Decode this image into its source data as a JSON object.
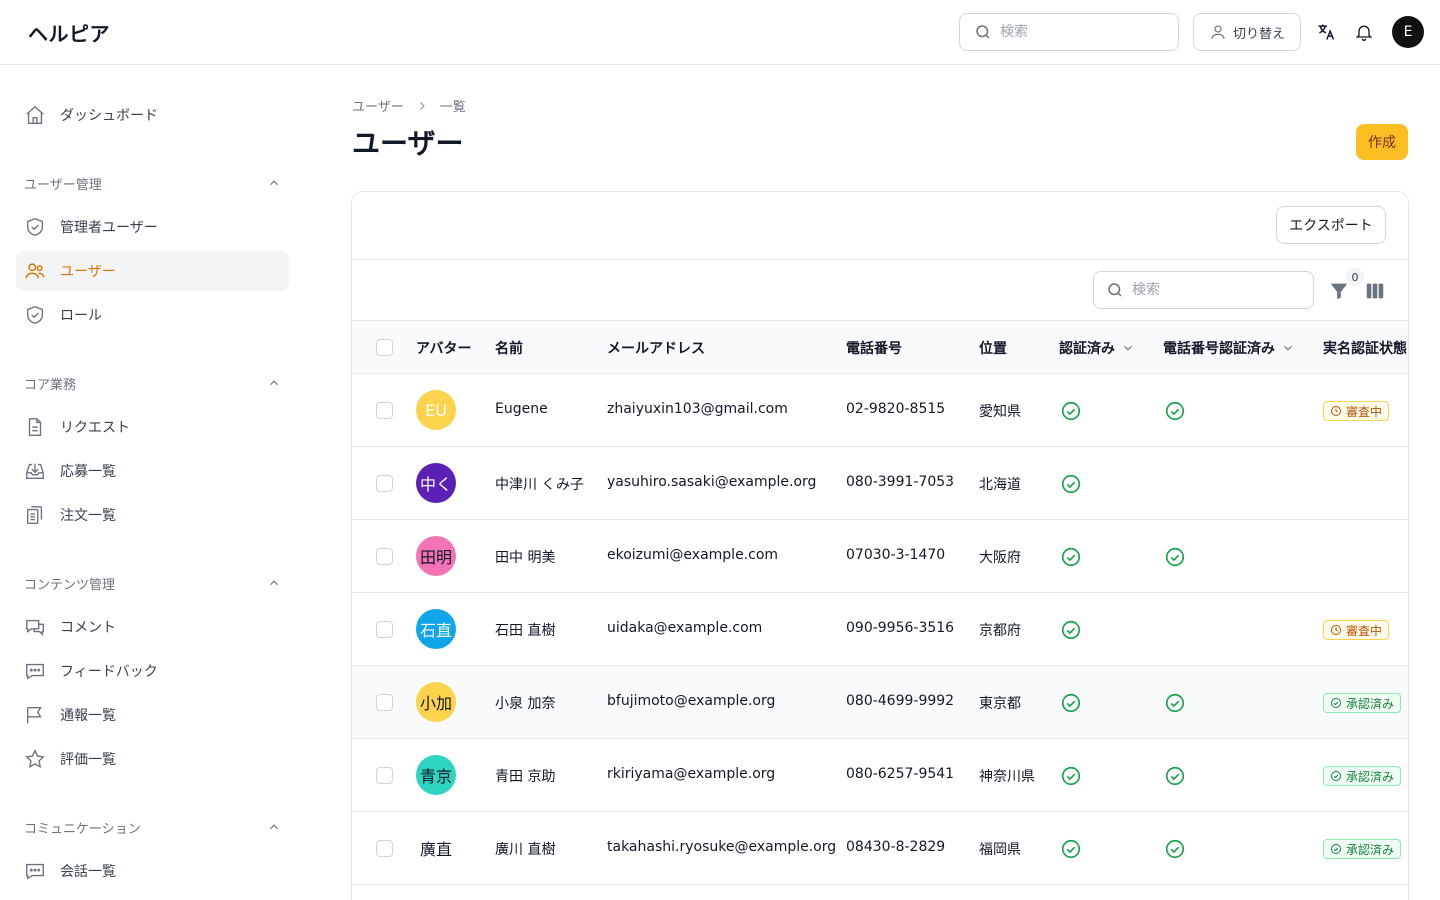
{
  "app": {
    "brand": "ヘルピア",
    "user_initial": "E"
  },
  "header": {
    "search_placeholder": "検索",
    "switch_label": "切り替え"
  },
  "sidebar": {
    "dashboard": "ダッシュボード",
    "groups": [
      {
        "title": "ユーザー管理",
        "items": [
          "管理者ユーザー",
          "ユーザー",
          "ロール"
        ]
      },
      {
        "title": "コア業務",
        "items": [
          "リクエスト",
          "応募一覧",
          "注文一覧"
        ]
      },
      {
        "title": "コンテンツ管理",
        "items": [
          "コメント",
          "フィードバック",
          "通報一覧",
          "評価一覧"
        ]
      },
      {
        "title": "コミュニケーション",
        "items": [
          "会話一覧"
        ]
      }
    ]
  },
  "page": {
    "breadcrumb": [
      "ユーザー",
      "一覧"
    ],
    "title": "ユーザー",
    "create_label": "作成",
    "export_label": "エクスポート",
    "table_search_placeholder": "検索",
    "filter_count": "0"
  },
  "table": {
    "columns": [
      "アバター",
      "名前",
      "メールアドレス",
      "電話番号",
      "位置",
      "認証済み",
      "電話番号認証済み",
      "実名認証状態"
    ],
    "rows": [
      {
        "avatar": "EU",
        "avatar_color": "#fcd34d",
        "avatar_text": "#ffffff",
        "name": "Eugene",
        "email": "zhaiyuxin103@gmail.com",
        "phone": "02-9820-8515",
        "location": "愛知県",
        "verified": true,
        "phone_verified": true,
        "kyc": "審査中"
      },
      {
        "avatar": "中く",
        "avatar_color": "#5b21b6",
        "avatar_text": "#ffffff",
        "name": "中津川 くみ子",
        "email": "yasuhiro.sasaki@example.org",
        "phone": "080-3991-7053",
        "location": "北海道",
        "verified": true,
        "phone_verified": false,
        "kyc": ""
      },
      {
        "avatar": "田明",
        "avatar_color": "#f472b6",
        "avatar_text": "#111827",
        "name": "田中 明美",
        "email": "ekoizumi@example.com",
        "phone": "07030-3-1470",
        "location": "大阪府",
        "verified": true,
        "phone_verified": true,
        "kyc": ""
      },
      {
        "avatar": "石直",
        "avatar_color": "#0ea5e9",
        "avatar_text": "#ffffff",
        "name": "石田 直樹",
        "email": "uidaka@example.com",
        "phone": "090-9956-3516",
        "location": "京都府",
        "verified": true,
        "phone_verified": false,
        "kyc": "審査中"
      },
      {
        "avatar": "小加",
        "avatar_color": "#fcd34d",
        "avatar_text": "#111827",
        "name": "小泉 加奈",
        "email": "bfujimoto@example.org",
        "phone": "080-4699-9992",
        "location": "東京都",
        "verified": true,
        "phone_verified": true,
        "kyc": "承認済み"
      },
      {
        "avatar": "青京",
        "avatar_color": "#2dd4bf",
        "avatar_text": "#111827",
        "name": "青田 京助",
        "email": "rkiriyama@example.org",
        "phone": "080-6257-9541",
        "location": "神奈川県",
        "verified": true,
        "phone_verified": true,
        "kyc": "承認済み"
      },
      {
        "avatar": "廣直",
        "avatar_color": "#ffffff",
        "avatar_text": "#111827",
        "name": "廣川 直樹",
        "email": "takahashi.ryosuke@example.org",
        "phone": "08430-8-2829",
        "location": "福岡県",
        "verified": true,
        "phone_verified": true,
        "kyc": "承認済み"
      }
    ]
  },
  "colors": {
    "accent": "#d97706",
    "create_bg": "#fbbf24",
    "success": "#16a34a"
  }
}
